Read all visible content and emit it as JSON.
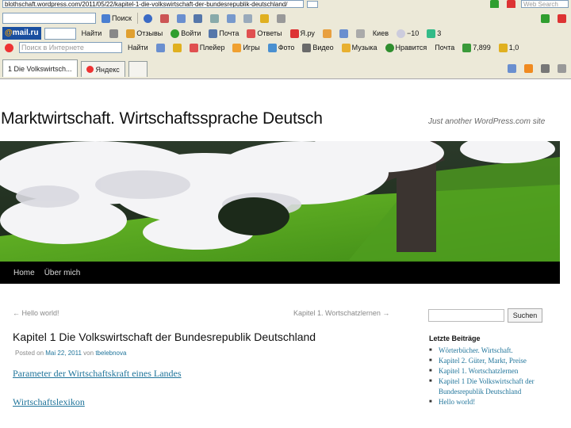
{
  "browser": {
    "address_url": "blothschaft.wordpress.com/2011/05/22/kapitel-1-die-volkswirtschaft-der-bundesrepublik-deutschland/",
    "web_search_placeholder": "Web Search",
    "search_button": "Поиск",
    "mailru_logo": "mail.ru",
    "mailru_find": "Найти",
    "mailru_reviews": "Отзывы",
    "mailru_login": "Войти",
    "mailru_mail": "Почта",
    "mailru_answers": "Ответы",
    "mailru_ya": "Я.ру",
    "mailru_city": "Киев",
    "mailru_temp": "−10",
    "mailru_count": "3",
    "yandex_search_placeholder": "Поиск в Интернете",
    "yandex_find": "Найти",
    "links_player": "Плейер",
    "links_games": "Игры",
    "links_photo": "Фото",
    "links_video": "Видео",
    "links_music": "Музыка",
    "links_like": "Нравится",
    "links_mail": "Почта",
    "links_rate": "7,899",
    "links_money": "1,0",
    "tabs": [
      {
        "label": "1 Die Volkswirtsch..."
      },
      {
        "label": "Яндекс"
      }
    ],
    "colors": {
      "chrome": "#ece9d8",
      "mailru_blue": "#1a4fa0"
    }
  },
  "blog": {
    "title": "Marktwirtschaft. Wirtschaftssprache Deutsch",
    "tagline": "Just another WordPress.com site",
    "nav": [
      "Home",
      "Über mich"
    ],
    "post_nav_prev": "← Hello world!",
    "post_nav_next": "Kapitel 1. Wortschatzlernen →",
    "post_title": "Kapitel 1 Die Volkswirtschaft der Bundesrepublik Deutschland",
    "meta_prefix": "Posted on",
    "meta_date": "Mai 22, 2011",
    "meta_by": "von",
    "meta_author": "tbelebnova",
    "link1": "Parameter der Wirtschaftskraft eines Landes",
    "link2": "Wirtschaftslexikon",
    "search_button": "Suchen",
    "recent_title": "Letzte Beiträge",
    "recent_posts": [
      "Wörterbücher. Wirtschaft.",
      "Kapitel 2. Güter, Markt, Preise",
      "Kapitel 1. Wortschatzlernen",
      "Kapitel 1 Die Volkswirtschaft der Bundesrepublik Deutschland",
      "Hello world!"
    ],
    "link_color": "#21759b"
  }
}
